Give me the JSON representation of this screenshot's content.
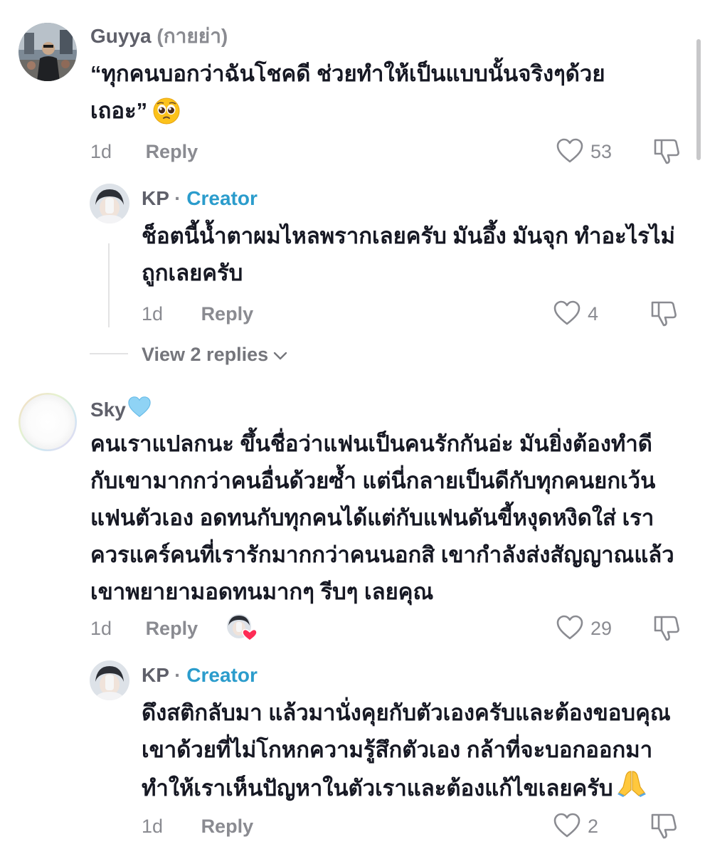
{
  "comments": [
    {
      "username": "Guyya",
      "alt_name": "(กายย่า)",
      "text_line1": "“ทุกคนบอกว่าฉันโชคดี ช่วยทำให้เป็นแบบนั้นจริงๆด้วย",
      "text_line2": "เถอะ”",
      "time": "1d",
      "reply_label": "Reply",
      "likes": "53",
      "reply": {
        "username": "KP",
        "separator": "·",
        "badge": "Creator",
        "text_line1": "ช็อตนี้น้ำตาผมไหลพรากเลยครับ มันอึ้ง มันจุก ทำอะไรไม่",
        "text_line2": "ถูกเลยครับ",
        "time": "1d",
        "reply_label": "Reply",
        "likes": "4"
      },
      "view_replies": "View 2 replies"
    },
    {
      "username": "Sky",
      "text_lines": [
        "คนเราแปลกนะ ขึ้นชื่อว่าแฟนเป็นคนรักกันอ่ะ มันยิ่งต้องทำดี",
        "กับเขามากกว่าคนอื่นด้วยซ้ำ แต่นี่กลายเป็นดีกับทุกคนยกเว้น",
        "แฟนตัวเอง อดทนกับทุกคนได้แต่กับแฟนดันขี้หงุดหงิดใส่ เรา",
        "ควรแคร์คนที่เรารักมากกว่าคนนอกสิ เขากำลังส่งสัญญาณแล้ว",
        "เขาพยายามอดทนมากๆ รีบๆ เลยคุณ"
      ],
      "time": "1d",
      "reply_label": "Reply",
      "likes": "29",
      "reply": {
        "username": "KP",
        "separator": "·",
        "badge": "Creator",
        "text_lines": [
          "ดึงสติกลับมา แล้วมานั่งคุยกับตัวเองครับและต้องขอบคุณ",
          "เขาด้วยที่ไม่โกหกความรู้สึกตัวเอง กล้าที่จะบอกออกมา",
          "ทำให้เราเห็นปัญหาในตัวเราและต้องแก้ไขเลยครับ"
        ],
        "time": "1d",
        "reply_label": "Reply",
        "likes": "2"
      }
    }
  ],
  "colors": {
    "creator": "#2b9ccc",
    "heart_small": "#fe2c55",
    "sky_heart": "#8fd3f5",
    "scrollbar": "#c7c7c9"
  },
  "icons": [
    "heart-outline-icon",
    "thumbs-down-icon",
    "chevron-down-icon",
    "pleading-face-emoji",
    "folded-hands-emoji",
    "light-blue-heart-emoji"
  ]
}
